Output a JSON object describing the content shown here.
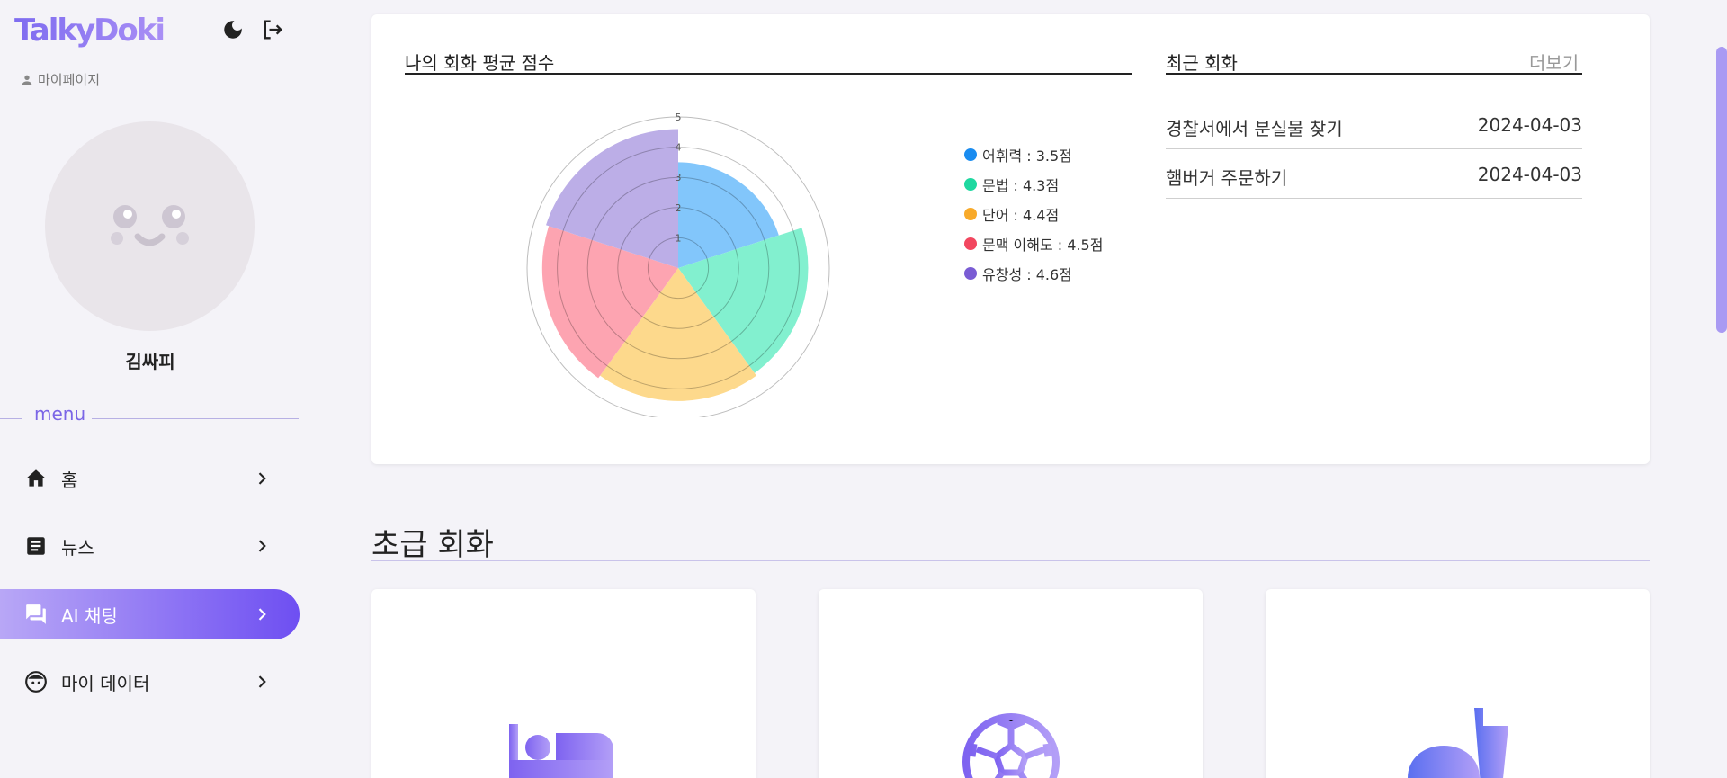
{
  "app": {
    "logo": "TalkyDoki"
  },
  "sidebar": {
    "mypage_label": "마이페이지",
    "username": "김싸피",
    "menu_label": "menu",
    "items": [
      {
        "label": "홈",
        "icon": "home-icon"
      },
      {
        "label": "뉴스",
        "icon": "article-icon"
      },
      {
        "label": "AI 채팅",
        "icon": "chat-icon",
        "active": true
      },
      {
        "label": "마이 데이터",
        "icon": "face-icon"
      }
    ]
  },
  "score_card": {
    "title": "나의 회화 평균 점수",
    "legend": [
      {
        "label": "어휘력 : 3.5점",
        "color": "#1a8cf0"
      },
      {
        "label": "문법 : 4.3점",
        "color": "#1fd8a0"
      },
      {
        "label": "단어 : 4.4점",
        "color": "#f8aa2a"
      },
      {
        "label": "문맥 이해도 : 4.5점",
        "color": "#f2475f"
      },
      {
        "label": "유창성 : 4.6점",
        "color": "#7a5cd4"
      }
    ]
  },
  "chart_data": {
    "type": "polar-area",
    "categories": [
      "어휘력",
      "문법",
      "단어",
      "문맥 이해도",
      "유창성"
    ],
    "values": [
      3.5,
      4.3,
      4.4,
      4.5,
      4.6
    ],
    "colors": [
      "#82c6fb",
      "#82f0cf",
      "#fdd98c",
      "#fda4b1",
      "#bcaee7"
    ],
    "rlim": [
      0,
      5
    ],
    "ticks": [
      "1",
      "2",
      "3",
      "4",
      "5"
    ]
  },
  "recent": {
    "title": "최근 회화",
    "more_label": "더보기",
    "items": [
      {
        "title": "경찰서에서 분실물 찾기",
        "date": "2024-04-03"
      },
      {
        "title": "햄버거 주문하기",
        "date": "2024-04-03"
      }
    ]
  },
  "beginner": {
    "title": "초급 회화",
    "cards": [
      {
        "icon": "hotel-bed-icon"
      },
      {
        "icon": "soccer-ball-icon"
      },
      {
        "icon": "fastfood-icon"
      }
    ]
  }
}
